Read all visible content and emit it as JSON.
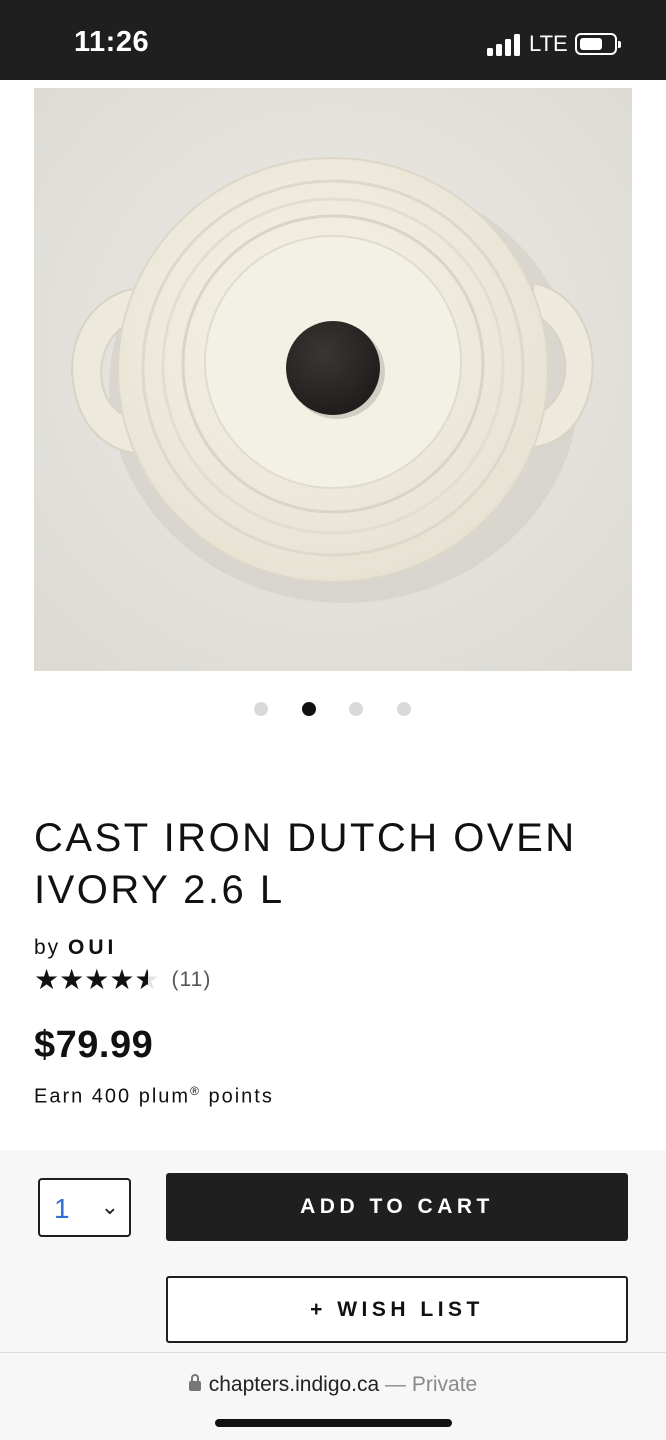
{
  "status_bar": {
    "time": "11:26",
    "network": "LTE",
    "icons": [
      "signal-bars-icon",
      "battery-icon"
    ]
  },
  "product": {
    "image_icon": "dutch-oven-photo",
    "carousel": {
      "count": 4,
      "active_index": 1
    },
    "title": "CAST IRON DUTCH OVEN IVORY 2.6 L",
    "by_label": "by",
    "brand": "OUI",
    "rating": {
      "value": 4.5,
      "max": 5
    },
    "review_count": "(11)",
    "price": "$79.99",
    "points": {
      "prefix": "Earn 400 plum",
      "mark": "®",
      "suffix": " points"
    }
  },
  "actions": {
    "quantity": "1",
    "add_to_cart": "ADD TO CART",
    "wish_list": "+ WISH LIST"
  },
  "browser": {
    "url": "chapters.indigo.ca",
    "separator": " — ",
    "privacy": "Private"
  },
  "colors": {
    "status_bar_bg": "#1f1f1f",
    "primary_button_bg": "#1f1f1f",
    "quantity_text": "#2f6fd6",
    "oven_ivory": "#f1eddf",
    "knob": "#2b2826"
  }
}
